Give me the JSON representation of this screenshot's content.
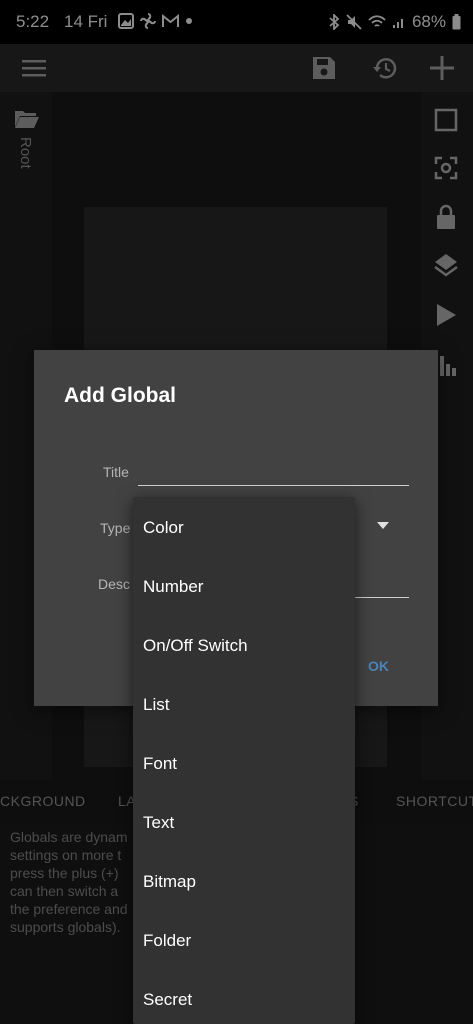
{
  "status": {
    "time": "5:22",
    "date": "14 Fri",
    "battery": "68%"
  },
  "toolbar": {
    "menu_icon": "menu-icon",
    "save_icon": "save-icon",
    "history_icon": "history-icon",
    "add_icon": "add-icon"
  },
  "left_panel": {
    "root_label": "Root"
  },
  "tabs": [
    {
      "label": "CKGROUND"
    },
    {
      "label": "LA"
    },
    {
      "label": "S"
    },
    {
      "label": "SHORTCUT"
    }
  ],
  "description": "Globals are dynam… to change settings on more t… new one just press the plus (+)… e screen, you can then switch a… y selecting the preference and… preferences supports globals).",
  "description_lines": [
    "Globals are dynam                                     to change",
    "settings on more t                                    new one just",
    "press the plus (+)                                    e screen, you",
    "can then switch a                                     y selecting",
    "the preference and                                    preferences",
    "supports globals)."
  ],
  "dialog": {
    "title": "Add Global",
    "title_label": "Title",
    "type_label": "Type",
    "desc_label": "Desc",
    "ok_label": "OK"
  },
  "dropdown": {
    "items": [
      "Color",
      "Number",
      "On/Off Switch",
      "List",
      "Font",
      "Text",
      "Bitmap",
      "Folder",
      "Secret"
    ]
  },
  "colors": {
    "accent": "#4a84b8",
    "dialog_bg": "#424242",
    "dropdown_bg": "#323232"
  }
}
